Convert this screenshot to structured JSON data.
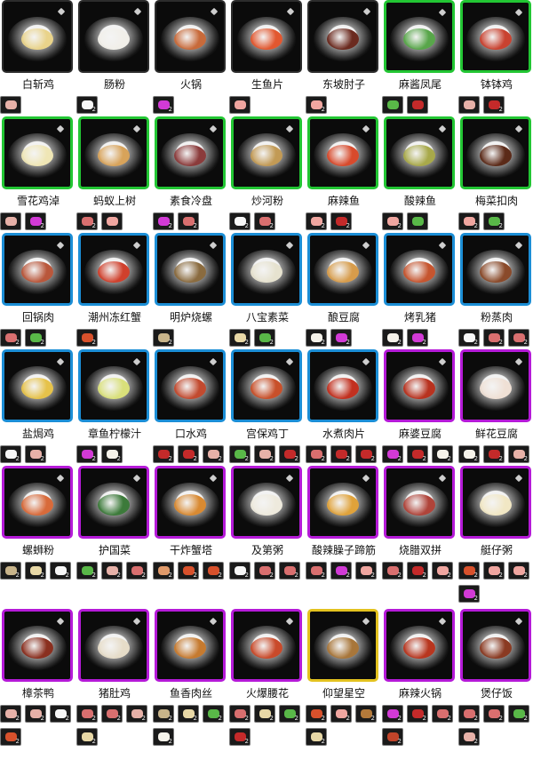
{
  "dishes": [
    {
      "name": "白斩鸡",
      "frame": "g",
      "food": "#e9d38a",
      "ings": [
        {
          "icon": "chicken-icon",
          "color": "#e7b1a8",
          "count": ""
        }
      ]
    },
    {
      "name": "肠粉",
      "frame": "g",
      "food": "#f1efe9",
      "ings": [
        {
          "icon": "rice-icon",
          "color": "#f7f7f7",
          "count": "2"
        }
      ]
    },
    {
      "name": "火锅",
      "frame": "g",
      "food": "#c86a3a",
      "ings": [
        {
          "icon": "magic-ingredient-icon",
          "color": "#d23ad6",
          "count": "2"
        }
      ]
    },
    {
      "name": "生鱼片",
      "frame": "g",
      "food": "#e2572f",
      "ings": [
        {
          "icon": "fish-icon",
          "color": "#f0a6a0",
          "count": ""
        }
      ]
    },
    {
      "name": "东坡肘子",
      "frame": "g",
      "food": "#6b2a1f",
      "ings": [
        {
          "icon": "pork-icon",
          "color": "#f0a6a0",
          "count": "2"
        }
      ]
    },
    {
      "name": "麻酱凤尾",
      "frame": "gr",
      "food": "#58a64a",
      "ings": [
        {
          "icon": "vegetable-icon",
          "color": "#59b848",
          "count": ""
        },
        {
          "icon": "chili-icon",
          "color": "#c42a2a",
          "count": ""
        }
      ]
    },
    {
      "name": "钵钵鸡",
      "frame": "gr",
      "food": "#c94230",
      "ings": [
        {
          "icon": "chicken-icon",
          "color": "#e7b1a8",
          "count": ""
        },
        {
          "icon": "chili-icon",
          "color": "#c42a2a",
          "count": "2"
        }
      ]
    },
    {
      "name": "雪花鸡淖",
      "frame": "gr",
      "food": "#efe6b5",
      "ings": [
        {
          "icon": "chicken-icon",
          "color": "#e7b1a8",
          "count": ""
        },
        {
          "icon": "magic-ingredient-icon",
          "color": "#d23ad6",
          "count": "2"
        }
      ]
    },
    {
      "name": "蚂蚁上树",
      "frame": "gr",
      "food": "#d8a35a",
      "ings": [
        {
          "icon": "meat-icon",
          "color": "#d96f6f",
          "count": "2"
        },
        {
          "icon": "pork-icon",
          "color": "#f0a6a0",
          "count": ""
        }
      ]
    },
    {
      "name": "素食冷盘",
      "frame": "gr",
      "food": "#8b3b3b",
      "ings": [
        {
          "icon": "magic-ingredient-icon",
          "color": "#d23ad6",
          "count": "2"
        },
        {
          "icon": "meat-icon",
          "color": "#d96f6f",
          "count": "2"
        }
      ]
    },
    {
      "name": "炒河粉",
      "frame": "gr",
      "food": "#c29a55",
      "ings": [
        {
          "icon": "rice-icon",
          "color": "#f7f7f7",
          "count": "2"
        },
        {
          "icon": "meat-icon",
          "color": "#d96f6f",
          "count": "2"
        }
      ]
    },
    {
      "name": "麻辣鱼",
      "frame": "gr",
      "food": "#d84a2c",
      "ings": [
        {
          "icon": "fish-icon",
          "color": "#f0a6a0",
          "count": "2"
        },
        {
          "icon": "chili-icon",
          "color": "#c42a2a",
          "count": "2"
        }
      ]
    },
    {
      "name": "酸辣鱼",
      "frame": "gr",
      "food": "#a8a94a",
      "ings": [
        {
          "icon": "fish-icon",
          "color": "#f0a6a0",
          "count": "2"
        },
        {
          "icon": "vegetable-icon",
          "color": "#59b848",
          "count": ""
        }
      ]
    },
    {
      "name": "梅菜扣肉",
      "frame": "gr",
      "food": "#5b2a18",
      "ings": [
        {
          "icon": "pork-icon",
          "color": "#f0a6a0",
          "count": "2"
        },
        {
          "icon": "vegetable-icon",
          "color": "#59b848",
          "count": "2"
        }
      ]
    },
    {
      "name": "回锅肉",
      "frame": "b",
      "food": "#b9573b",
      "ings": [
        {
          "icon": "meat-icon",
          "color": "#d96f6f",
          "count": "2"
        },
        {
          "icon": "vegetable-icon",
          "color": "#59b848",
          "count": "2"
        }
      ]
    },
    {
      "name": "潮州冻红蟹",
      "frame": "b",
      "food": "#d0402c",
      "ings": [
        {
          "icon": "crab-icon",
          "color": "#d8512c",
          "count": "2"
        }
      ]
    },
    {
      "name": "明炉烧螺",
      "frame": "b",
      "food": "#8a6b3f",
      "ings": [
        {
          "icon": "snail-icon",
          "color": "#c8b48a",
          "count": "2"
        }
      ]
    },
    {
      "name": "八宝素菜",
      "frame": "b",
      "food": "#e6e2cf",
      "ings": [
        {
          "icon": "dumpling-icon",
          "color": "#e8d8a6",
          "count": "2"
        },
        {
          "icon": "vegetable-icon",
          "color": "#59b848",
          "count": "2"
        }
      ]
    },
    {
      "name": "酿豆腐",
      "frame": "b",
      "food": "#d79c4b",
      "ings": [
        {
          "icon": "tofu-icon",
          "color": "#f5f2ea",
          "count": "2"
        },
        {
          "icon": "magic-ingredient-icon",
          "color": "#d23ad6",
          "count": "2"
        }
      ]
    },
    {
      "name": "烤乳猪",
      "frame": "b",
      "food": "#c6552f",
      "ings": [
        {
          "icon": "tofu-icon",
          "color": "#f5f2ea",
          "count": "2"
        },
        {
          "icon": "magic-ingredient-icon",
          "color": "#d23ad6",
          "count": "2"
        }
      ]
    },
    {
      "name": "粉蒸肉",
      "frame": "b",
      "food": "#8a4a2a",
      "ings": [
        {
          "icon": "rice-icon",
          "color": "#f7f7f7",
          "count": "2"
        },
        {
          "icon": "meat-icon",
          "color": "#d96f6f",
          "count": "2"
        },
        {
          "icon": "meat-icon",
          "color": "#d96f6f",
          "count": "2"
        }
      ]
    },
    {
      "name": "盐焗鸡",
      "frame": "b",
      "food": "#e6c24a",
      "ings": [
        {
          "icon": "salt-icon",
          "color": "#f7f7f7",
          "count": "2"
        },
        {
          "icon": "chicken-icon",
          "color": "#e7b1a8",
          "count": "2"
        }
      ]
    },
    {
      "name": "章鱼柠檬汁",
      "frame": "b",
      "food": "#d9e07a",
      "ings": [
        {
          "icon": "magic-ingredient-icon",
          "color": "#d23ad6",
          "count": "2"
        },
        {
          "icon": "tofu-icon",
          "color": "#f5f2ea",
          "count": "2"
        }
      ]
    },
    {
      "name": "口水鸡",
      "frame": "b",
      "food": "#c24a2f",
      "ings": [
        {
          "icon": "chili-icon",
          "color": "#c42a2a",
          "count": "2"
        },
        {
          "icon": "chili-icon",
          "color": "#c42a2a",
          "count": "2"
        },
        {
          "icon": "chicken-icon",
          "color": "#e7b1a8",
          "count": "2"
        }
      ]
    },
    {
      "name": "宫保鸡丁",
      "frame": "b",
      "food": "#c8502a",
      "ings": [
        {
          "icon": "vegetable-icon",
          "color": "#59b848",
          "count": "2"
        },
        {
          "icon": "chicken-icon",
          "color": "#e7b1a8",
          "count": "2"
        },
        {
          "icon": "chili-icon",
          "color": "#c42a2a",
          "count": "2"
        }
      ]
    },
    {
      "name": "水煮肉片",
      "frame": "b",
      "food": "#c2301f",
      "ings": [
        {
          "icon": "meat-icon",
          "color": "#d96f6f",
          "count": "2"
        },
        {
          "icon": "chili-icon",
          "color": "#c42a2a",
          "count": "2"
        },
        {
          "icon": "chili-icon",
          "color": "#c42a2a",
          "count": "2"
        }
      ]
    },
    {
      "name": "麻婆豆腐",
      "frame": "p",
      "food": "#b8321f",
      "ings": [
        {
          "icon": "magic-ingredient-icon",
          "color": "#d23ad6",
          "count": "2"
        },
        {
          "icon": "chili-icon",
          "color": "#c42a2a",
          "count": "2"
        },
        {
          "icon": "tofu-icon",
          "color": "#f5f2ea",
          "count": "2"
        }
      ]
    },
    {
      "name": "鲜花豆腐",
      "frame": "p",
      "food": "#efe0d5",
      "ings": [
        {
          "icon": "tofu-icon",
          "color": "#f5f2ea",
          "count": "2"
        },
        {
          "icon": "chili-icon",
          "color": "#c42a2a",
          "count": "2"
        },
        {
          "icon": "chicken-icon",
          "color": "#e7b1a8",
          "count": "2"
        }
      ]
    },
    {
      "name": "螺蛳粉",
      "frame": "p",
      "food": "#d86a3a",
      "ings": [
        {
          "icon": "snail-icon",
          "color": "#c8b48a",
          "count": "2"
        },
        {
          "icon": "dumpling-icon",
          "color": "#e8d8a6",
          "count": "2"
        },
        {
          "icon": "rice-icon",
          "color": "#f7f7f7",
          "count": "2"
        }
      ]
    },
    {
      "name": "护国菜",
      "frame": "p",
      "food": "#3c7a3a",
      "ings": [
        {
          "icon": "vegetable-icon",
          "color": "#59b848",
          "count": "2"
        },
        {
          "icon": "chicken-icon",
          "color": "#e7b1a8",
          "count": "2"
        },
        {
          "icon": "meat-icon",
          "color": "#d96f6f",
          "count": "2"
        }
      ]
    },
    {
      "name": "干炸蟹塔",
      "frame": "p",
      "food": "#d98a32",
      "ings": [
        {
          "icon": "shrimp-icon",
          "color": "#e09a6a",
          "count": "2"
        },
        {
          "icon": "crab-icon",
          "color": "#d8512c",
          "count": "2"
        },
        {
          "icon": "crab-icon",
          "color": "#d8512c",
          "count": "2"
        }
      ]
    },
    {
      "name": "及第粥",
      "frame": "p",
      "food": "#eeeadd",
      "ings": [
        {
          "icon": "rice-icon",
          "color": "#f7f7f7",
          "count": "2"
        },
        {
          "icon": "meat-icon",
          "color": "#d96f6f",
          "count": "2"
        },
        {
          "icon": "meat-icon",
          "color": "#d96f6f",
          "count": "2"
        }
      ]
    },
    {
      "name": "酸辣臊子蹄筋",
      "frame": "p",
      "food": "#e0a23a",
      "ings": [
        {
          "icon": "meat-icon",
          "color": "#d96f6f",
          "count": "2"
        },
        {
          "icon": "magic-ingredient-icon",
          "color": "#d23ad6",
          "count": "2"
        },
        {
          "icon": "pork-icon",
          "color": "#f0a6a0",
          "count": "2"
        }
      ]
    },
    {
      "name": "烧腊双拼",
      "frame": "p",
      "food": "#b0443a",
      "ings": [
        {
          "icon": "meat-icon",
          "color": "#d96f6f",
          "count": "2"
        },
        {
          "icon": "chili-icon",
          "color": "#c42a2a",
          "count": "2"
        },
        {
          "icon": "pork-icon",
          "color": "#f0a6a0",
          "count": "2"
        }
      ]
    },
    {
      "name": "艇仔粥",
      "frame": "p",
      "food": "#f1e7c4",
      "ings": [
        {
          "icon": "crab-icon",
          "color": "#d8512c",
          "count": "2"
        },
        {
          "icon": "pork-icon",
          "color": "#f0a6a0",
          "count": "2"
        },
        {
          "icon": "fish-icon",
          "color": "#f0a6a0",
          "count": "2"
        },
        {
          "icon": "magic-ingredient-icon",
          "color": "#d23ad6",
          "count": "2"
        }
      ]
    },
    {
      "name": "樟茶鸭",
      "frame": "p",
      "food": "#8a2f1f",
      "ings": [
        {
          "icon": "chicken-icon",
          "color": "#e7b1a8",
          "count": "2"
        },
        {
          "icon": "chicken-icon",
          "color": "#e7b1a8",
          "count": "2"
        },
        {
          "icon": "rice-icon",
          "color": "#f7f7f7",
          "count": "2"
        },
        {
          "icon": "crab-icon",
          "color": "#d8512c",
          "count": "2"
        }
      ]
    },
    {
      "name": "猪肚鸡",
      "frame": "p",
      "food": "#e6dcc8",
      "ings": [
        {
          "icon": "meat-icon",
          "color": "#d96f6f",
          "count": "2"
        },
        {
          "icon": "meat-icon",
          "color": "#d96f6f",
          "count": "2"
        },
        {
          "icon": "chicken-icon",
          "color": "#e7b1a8",
          "count": "2"
        },
        {
          "icon": "dumpling-icon",
          "color": "#e8d8a6",
          "count": "2"
        }
      ]
    },
    {
      "name": "鱼香肉丝",
      "frame": "p",
      "food": "#c67a2f",
      "ings": [
        {
          "icon": "snail-icon",
          "color": "#c8b48a",
          "count": "2"
        },
        {
          "icon": "dumpling-icon",
          "color": "#e8d8a6",
          "count": "2"
        },
        {
          "icon": "vegetable-icon",
          "color": "#59b848",
          "count": "2"
        },
        {
          "icon": "tofu-icon",
          "color": "#f5f2ea",
          "count": "2"
        }
      ]
    },
    {
      "name": "火爆腰花",
      "frame": "p",
      "food": "#c94a2a",
      "ings": [
        {
          "icon": "meat-icon",
          "color": "#d96f6f",
          "count": "2"
        },
        {
          "icon": "dumpling-icon",
          "color": "#e8d8a6",
          "count": "2"
        },
        {
          "icon": "vegetable-icon",
          "color": "#59b848",
          "count": "2"
        },
        {
          "icon": "chili-icon",
          "color": "#c42a2a",
          "count": "2"
        }
      ]
    },
    {
      "name": "仰望星空",
      "frame": "y",
      "food": "#a8763a",
      "ings": [
        {
          "icon": "crab-icon",
          "color": "#d8512c",
          "count": "2"
        },
        {
          "icon": "fish-icon",
          "color": "#f0a6a0",
          "count": "2"
        },
        {
          "icon": "coral-icon",
          "color": "#b47a3a",
          "count": "2"
        },
        {
          "icon": "dumpling-icon",
          "color": "#e8d8a6",
          "count": "2"
        }
      ]
    },
    {
      "name": "麻辣火锅",
      "frame": "p",
      "food": "#b8361f",
      "ings": [
        {
          "icon": "magic-ingredient-icon",
          "color": "#d23ad6",
          "count": "2"
        },
        {
          "icon": "chili-icon",
          "color": "#c42a2a",
          "count": "2"
        },
        {
          "icon": "meat-icon",
          "color": "#d96f6f",
          "count": "2"
        },
        {
          "icon": "coral-icon",
          "color": "#c0442a",
          "count": "2"
        }
      ]
    },
    {
      "name": "煲仔饭",
      "frame": "p",
      "food": "#8a3a22",
      "ings": [
        {
          "icon": "meat-icon",
          "color": "#d96f6f",
          "count": "2"
        },
        {
          "icon": "meat-icon",
          "color": "#d96f6f",
          "count": "2"
        },
        {
          "icon": "vegetable-icon",
          "color": "#59b848",
          "count": "2"
        },
        {
          "icon": "chicken-icon",
          "color": "#e7b1a8",
          "count": "2"
        }
      ]
    }
  ]
}
